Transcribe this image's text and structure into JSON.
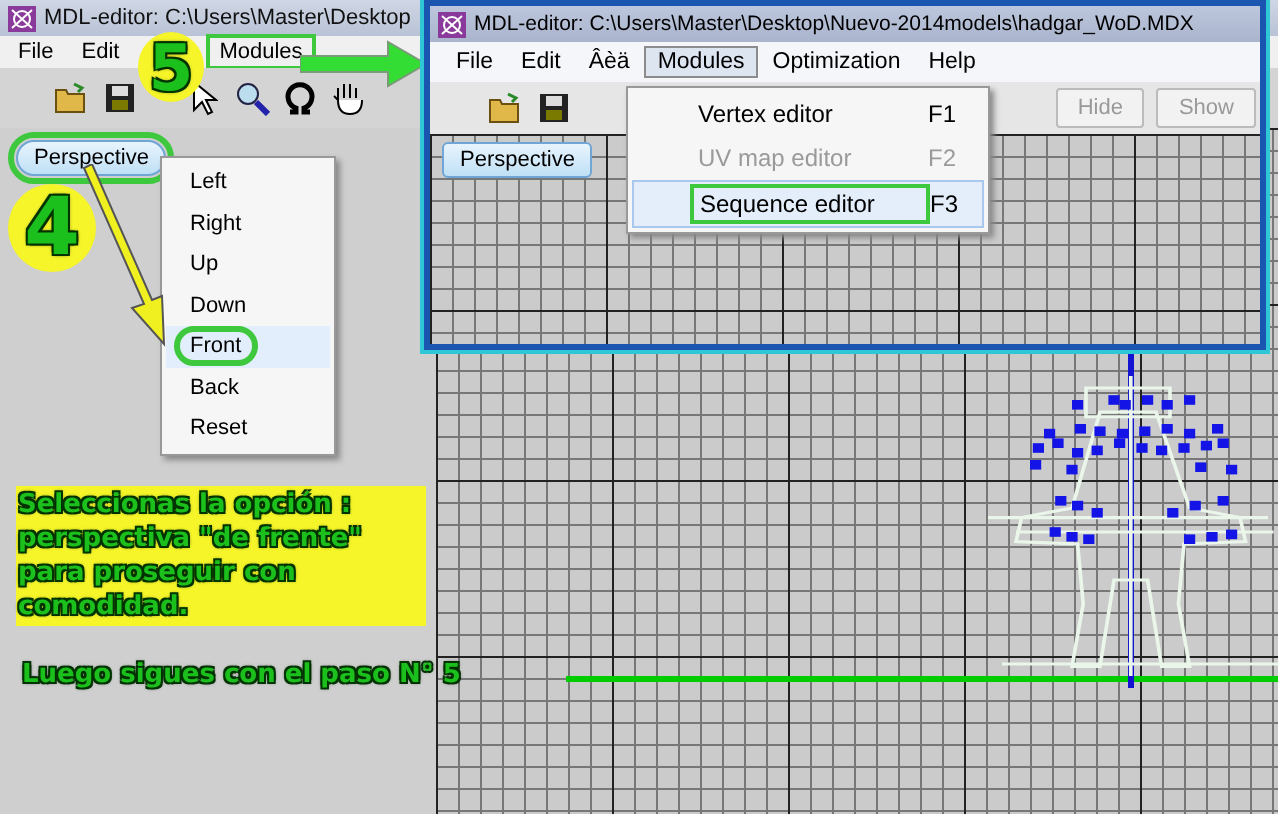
{
  "main_window": {
    "title": "MDL-editor: C:\\Users\\Master\\Desktop",
    "menu": [
      {
        "label": "File",
        "circled": false
      },
      {
        "label": "Edit",
        "circled": false
      },
      {
        "label": "Modules",
        "circled": true
      }
    ],
    "view_button": {
      "label": "Perspective",
      "circled": true
    },
    "view_menu": [
      {
        "label": "Left",
        "selected": false
      },
      {
        "label": "Right",
        "selected": false
      },
      {
        "label": "Up",
        "selected": false
      },
      {
        "label": "Down",
        "selected": false
      },
      {
        "label": "Front",
        "selected": true
      },
      {
        "label": "Back",
        "selected": false
      },
      {
        "label": "Reset",
        "selected": false
      }
    ]
  },
  "inset_window": {
    "title": "MDL-editor: C:\\Users\\Master\\Desktop\\Nuevo-2014models\\hadgar_WoD.MDX",
    "menu": [
      {
        "label": "File",
        "open": false
      },
      {
        "label": "Edit",
        "open": false
      },
      {
        "label": "Âèä",
        "open": false
      },
      {
        "label": "Modules",
        "open": true
      },
      {
        "label": "Optimization",
        "open": false
      },
      {
        "label": "Help",
        "open": false
      }
    ],
    "modules_menu": [
      {
        "label": "Vertex editor",
        "shortcut": "F1",
        "disabled": false,
        "selected": false
      },
      {
        "label": "UV map editor",
        "shortcut": "F2",
        "disabled": true,
        "selected": false
      },
      {
        "label": "Sequence editor",
        "shortcut": "F3",
        "disabled": false,
        "selected": true
      }
    ],
    "toolbar_buttons": [
      {
        "label": "Hide",
        "disabled": true
      },
      {
        "label": "Show",
        "disabled": true
      }
    ],
    "view_button": "Perspective"
  },
  "callouts": [
    {
      "number": "4"
    },
    {
      "number": "5"
    }
  ],
  "note": "Seleccionas la opción :\n perspectiva \"de frente\"\npara proseguir con\ncomodidad.",
  "next_step": "Luego sigues con el paso N° 5"
}
